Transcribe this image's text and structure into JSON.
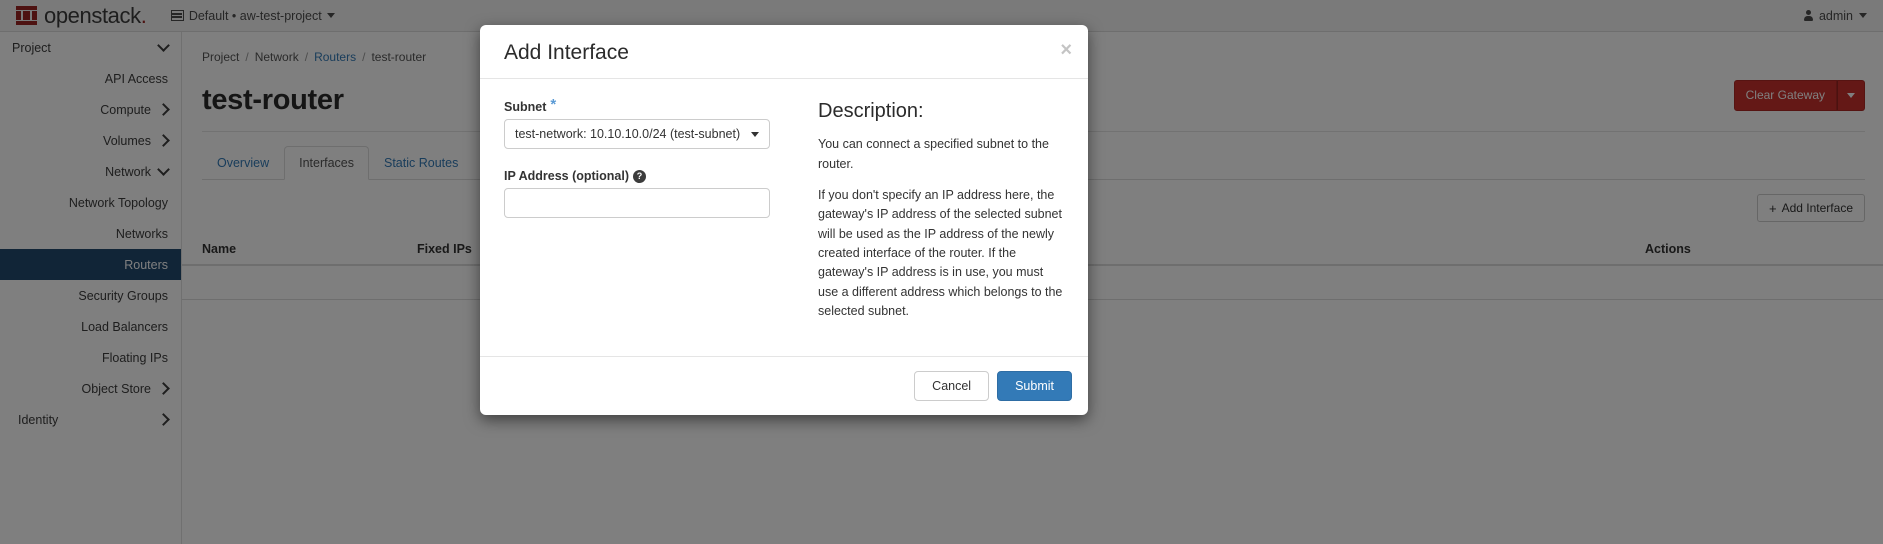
{
  "navbar": {
    "logo_text": "openstack",
    "logo_dot": ".",
    "context": "Default • aw-test-project",
    "user": "admin",
    "grid_icon": "grid-icon",
    "caret_icon": "chevron-down-icon",
    "user_icon": "person-icon"
  },
  "sidebar": {
    "items": [
      {
        "label": "Project",
        "type": "group",
        "chevron": "down",
        "active": false
      },
      {
        "label": "API Access",
        "type": "leaf",
        "chevron": "",
        "active": false
      },
      {
        "label": "Compute",
        "type": "group",
        "chevron": "right",
        "active": false
      },
      {
        "label": "Volumes",
        "type": "group",
        "chevron": "right",
        "active": false
      },
      {
        "label": "Network",
        "type": "group",
        "chevron": "down",
        "active": false
      },
      {
        "label": "Network Topology",
        "type": "leaf",
        "chevron": "",
        "active": false
      },
      {
        "label": "Networks",
        "type": "leaf",
        "chevron": "",
        "active": false
      },
      {
        "label": "Routers",
        "type": "leaf",
        "chevron": "",
        "active": true
      },
      {
        "label": "Security Groups",
        "type": "leaf",
        "chevron": "",
        "active": false
      },
      {
        "label": "Load Balancers",
        "type": "leaf",
        "chevron": "",
        "active": false
      },
      {
        "label": "Floating IPs",
        "type": "leaf",
        "chevron": "",
        "active": false
      },
      {
        "label": "Object Store",
        "type": "group",
        "chevron": "right",
        "active": false
      },
      {
        "label": "Identity",
        "type": "group",
        "chevron": "right",
        "active": false
      }
    ]
  },
  "breadcrumb": {
    "project": "Project",
    "network": "Network",
    "routers": "Routers",
    "current": "test-router",
    "separator": "/"
  },
  "page": {
    "title": "test-router",
    "clear_gateway_label": "Clear Gateway",
    "add_interface_label": "Add Interface",
    "add_interface_plus": "+"
  },
  "tabs": [
    {
      "label": "Overview",
      "active": false
    },
    {
      "label": "Interfaces",
      "active": true
    },
    {
      "label": "Static Routes",
      "active": false
    }
  ],
  "table": {
    "columns": [
      "Name",
      "Fixed IPs",
      "Actions"
    ],
    "rows": []
  },
  "modal": {
    "title": "Add Interface",
    "close_icon": "close-icon",
    "subnet_label": "Subnet",
    "subnet_required_mark": "*",
    "subnet_value": "test-network: 10.10.10.0/24 (test-subnet)",
    "ip_label": "IP Address (optional)",
    "ip_help_icon": "help-icon",
    "ip_help_glyph": "?",
    "ip_value": "",
    "ip_placeholder": "",
    "description_title": "Description:",
    "description_p1": "You can connect a specified subnet to the router.",
    "description_p2": "If you don't specify an IP address here, the gateway's IP address of the selected subnet will be used as the IP address of the newly created interface of the router. If the gateway's IP address is in use, you must use a different address which belongs to the selected subnet.",
    "cancel_label": "Cancel",
    "submit_label": "Submit"
  },
  "colors": {
    "brand_red": "#9b2423",
    "sidebar_active": "#224b6f",
    "link_blue": "#337ab7",
    "danger_red": "#c9302c",
    "primary_blue": "#337ab7"
  }
}
